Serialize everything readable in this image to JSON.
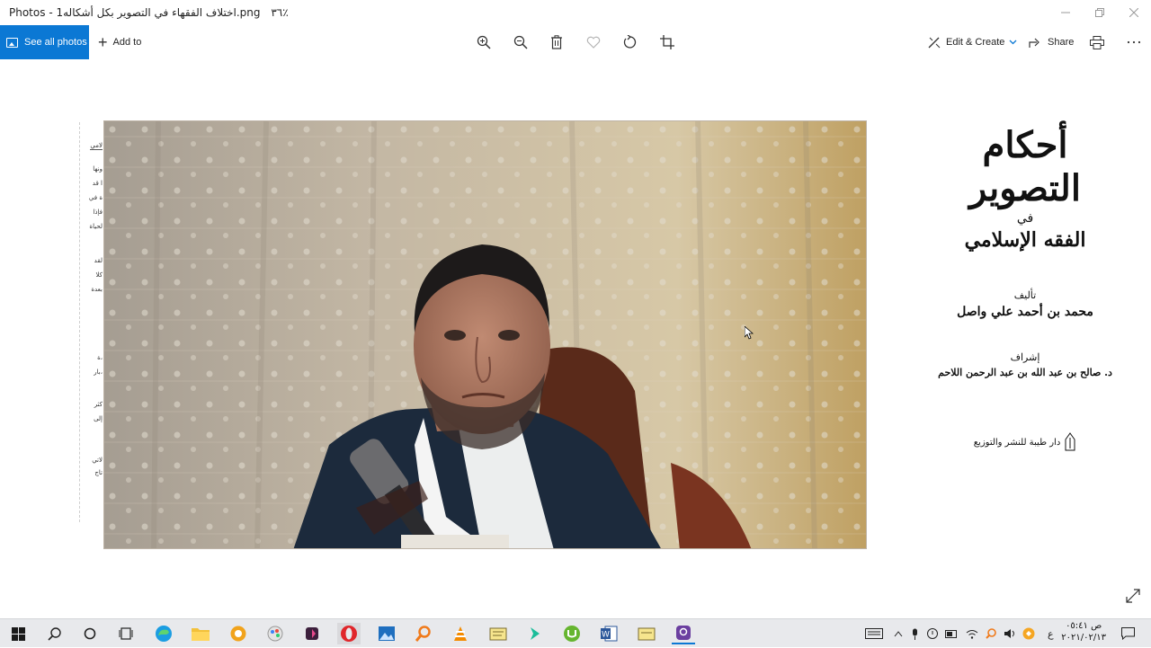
{
  "window": {
    "app": "Photos",
    "filename": "اختلاف الفقهاء في التصوير بكل أشكاله1.png",
    "zoom": "٣٦٪"
  },
  "toolbar": {
    "see_all_photos": "See all photos",
    "add_to": "Add to",
    "edit_create": "Edit & Create",
    "share": "Share"
  },
  "book_cover": {
    "title": "أحكام التصوير",
    "fi": "في",
    "subtitle": "الفقه الإسلامي",
    "author_label": "تأليف",
    "author": "محمد بن أحمد علي واصل",
    "supervision_label": "إشراف",
    "supervisor": "د. صالح بن عبد الله بن عبد الرحمن اللاحم",
    "publisher": "دار طيبة للنشر والتوزيع"
  },
  "left_page_fragments": [
    "لامي",
    "ونها",
    "ا قد",
    "ة في",
    "فإذا",
    "لحياة",
    "لقد",
    "كلا",
    "بعدة",
    "ة،",
    "بار،",
    "كثر",
    "إلى",
    "لاتي",
    "تاج"
  ],
  "taskbar": {
    "clock_time": "ص ٠٥:٤١",
    "clock_date": "٢٠٢١/٠٢/١٣",
    "lang": "ع"
  },
  "colors": {
    "accent": "#0b78d4",
    "taskbar": "#e8e9ec"
  }
}
